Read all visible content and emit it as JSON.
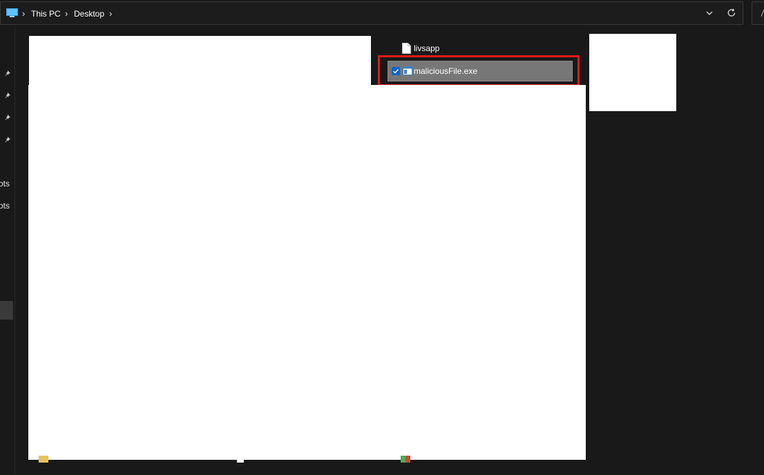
{
  "address_bar": {
    "breadcrumb": [
      "This PC",
      "Desktop"
    ]
  },
  "nav": {
    "partial_items": [
      "ots",
      "ots"
    ]
  },
  "files": {
    "top_item": "livsapp",
    "selected_item": "maliciousFile.exe"
  },
  "colors": {
    "background": "#191919",
    "highlight": "#e01a1a",
    "selection": "#777777",
    "checkbox": "#0a64c8"
  },
  "icons": {
    "pc": "this-pc-icon",
    "pin": "pin-icon",
    "refresh": "refresh-icon",
    "dropdown": "chevron-down-icon",
    "file": "file-icon",
    "exe": "exe-icon"
  }
}
